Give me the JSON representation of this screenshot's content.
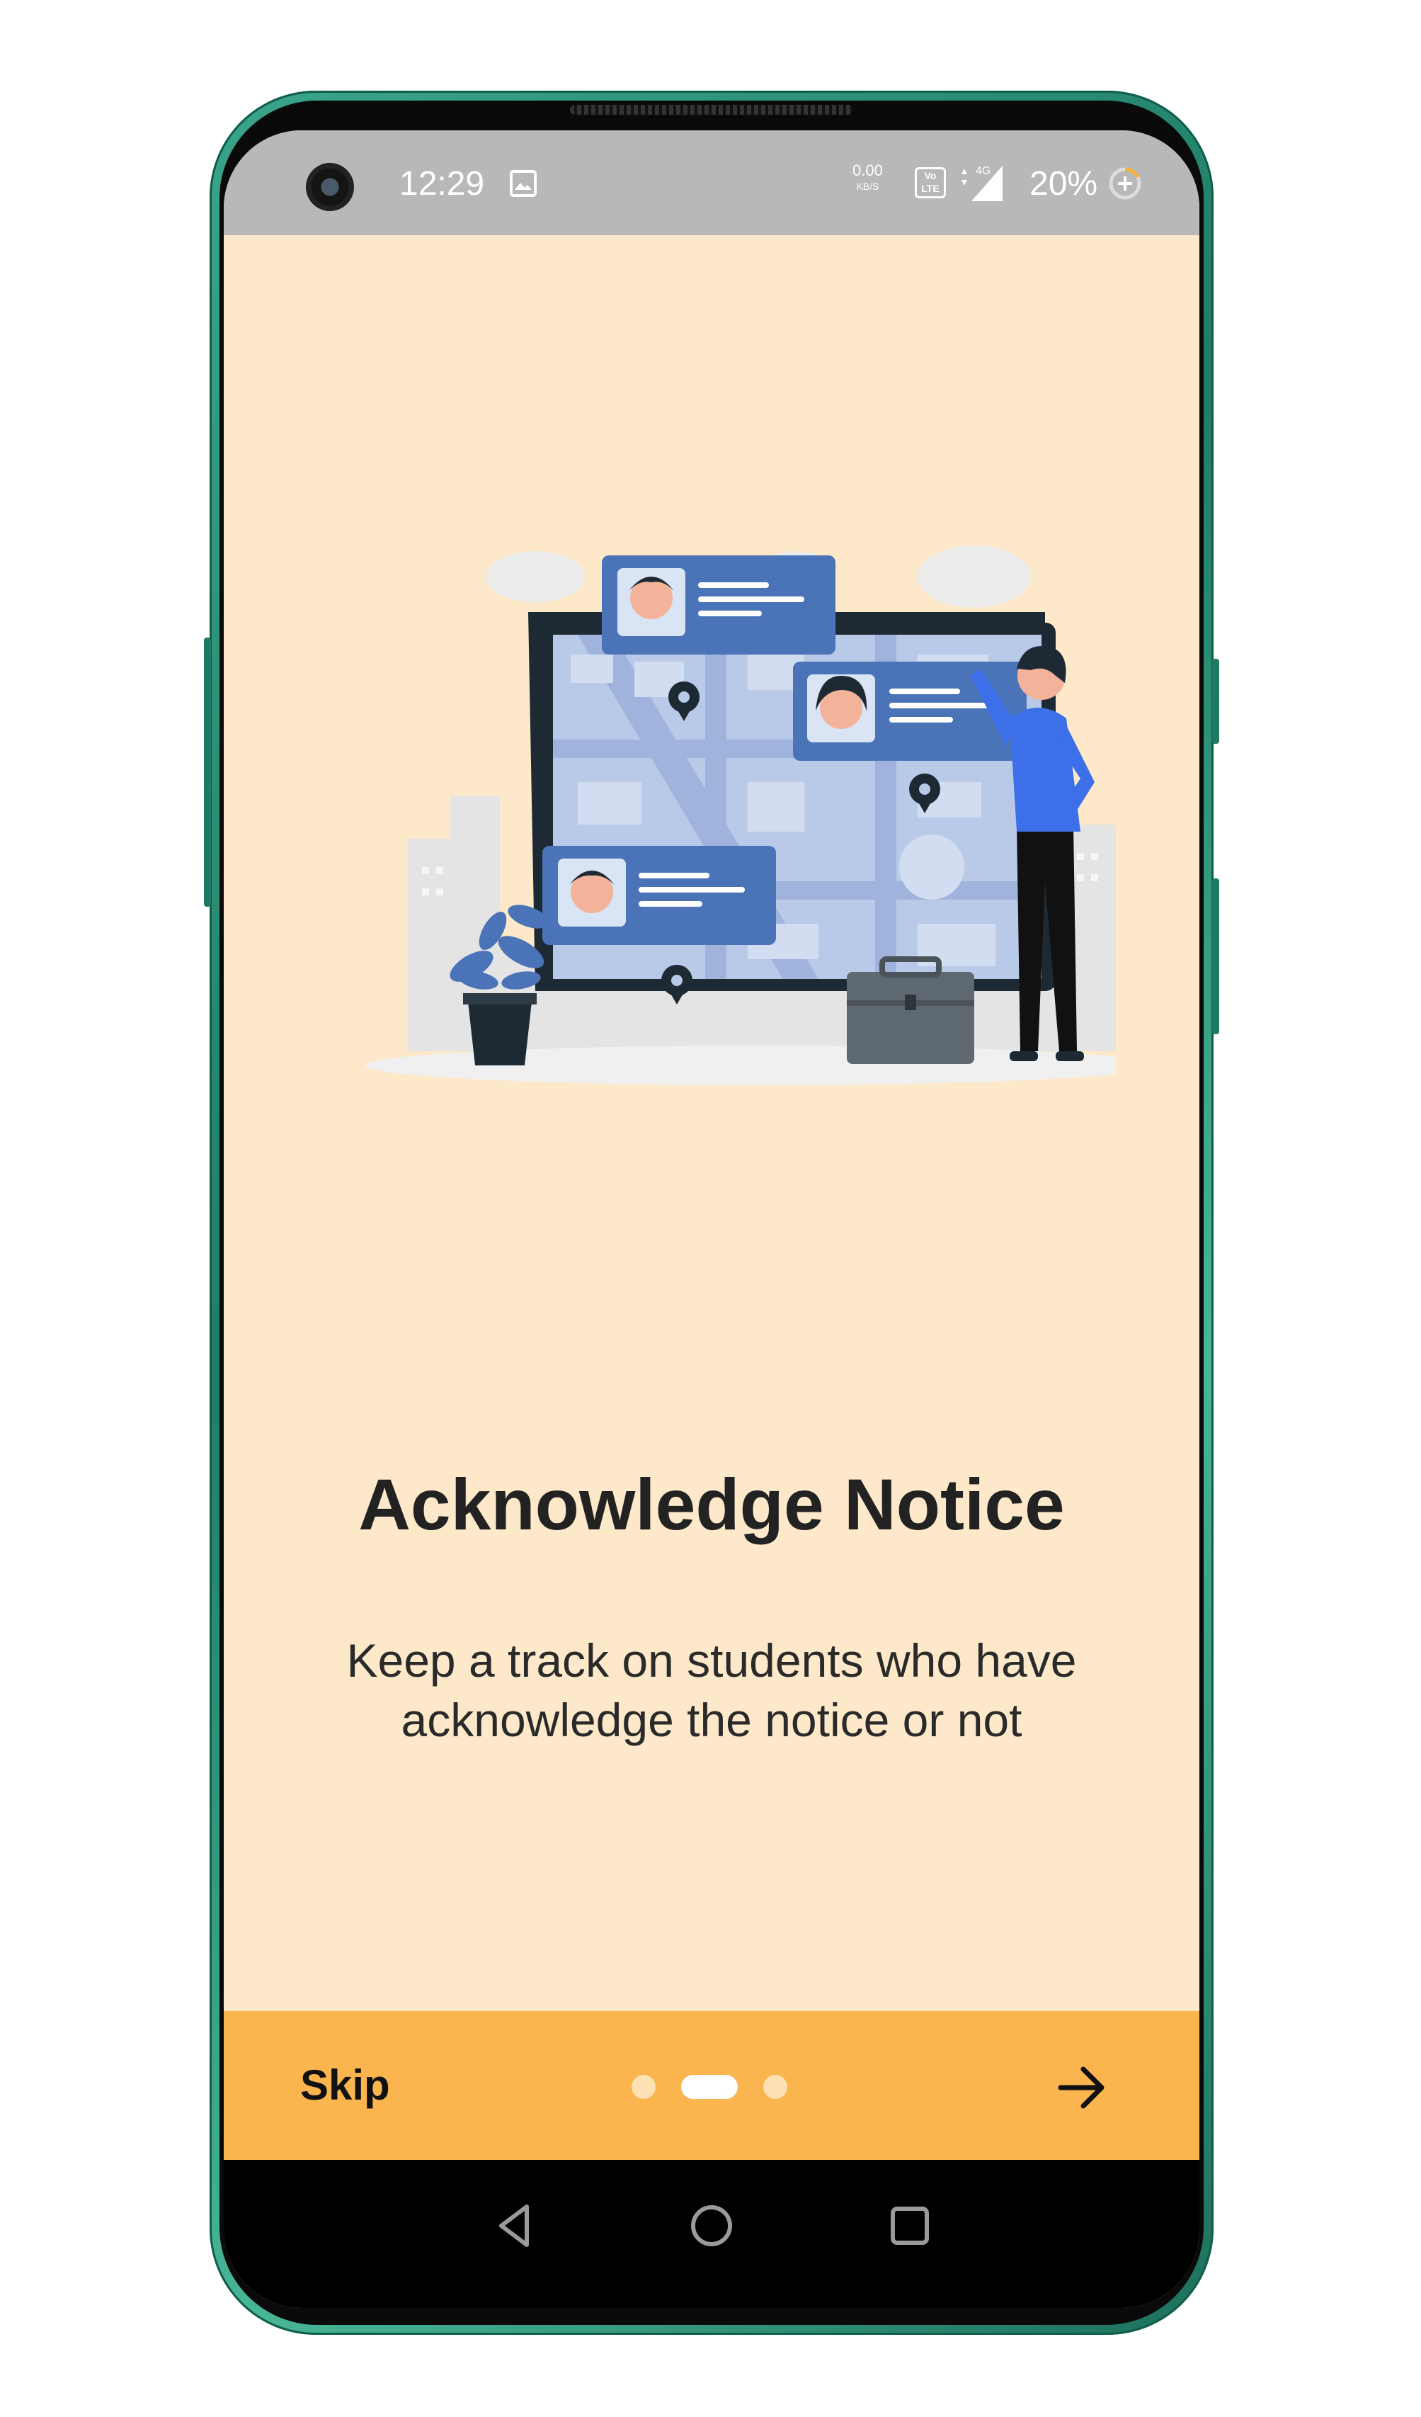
{
  "status_bar": {
    "time": "12:29",
    "net_speed_value": "0.00",
    "net_speed_unit": "KB/S",
    "volte_label": "Vo LTE",
    "network_type": "4G",
    "battery_percent": "20%",
    "icons": [
      "camera-icon",
      "gallery-icon",
      "volte-icon",
      "signal-icon",
      "battery-icon"
    ]
  },
  "onboarding": {
    "title": "Acknowledge Notice",
    "description": "Keep a track on students who have acknowledge the notice or not",
    "current_page": 2,
    "total_pages": 3
  },
  "action_bar": {
    "skip_label": "Skip",
    "next_icon": "arrow-right-icon",
    "background": "#FBB54F"
  },
  "nav_bar": {
    "buttons": [
      "back-icon",
      "home-icon",
      "recents-icon"
    ]
  },
  "colors": {
    "screen_background": "#FDE9C9",
    "frame": "#2E8F76",
    "illustration_blue": "#4A73B8",
    "person_shirt": "#3D6FE8"
  }
}
